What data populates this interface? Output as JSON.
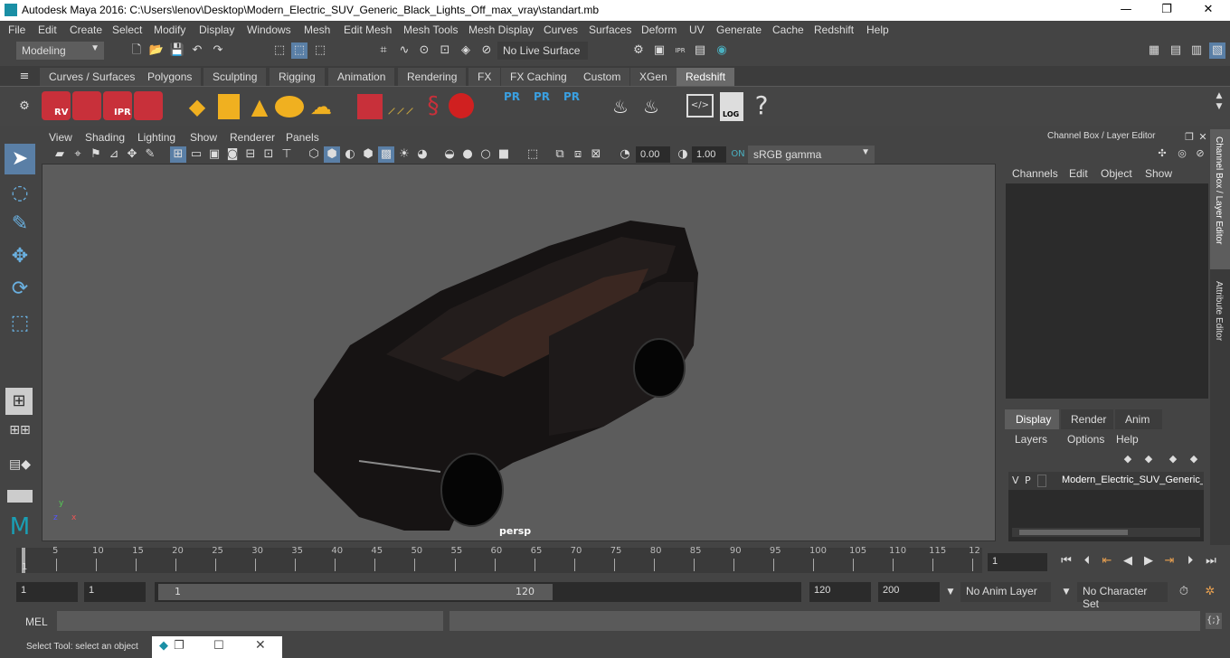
{
  "window": {
    "title": "Autodesk Maya 2016: C:\\Users\\lenov\\Desktop\\Modern_Electric_SUV_Generic_Black_Lights_Off_max_vray\\standart.mb",
    "minimize": "—",
    "maximize": "❐",
    "close": "✕"
  },
  "menu": [
    "File",
    "Edit",
    "Create",
    "Select",
    "Modify",
    "Display",
    "Windows",
    "Mesh",
    "Edit Mesh",
    "Mesh Tools",
    "Mesh Display",
    "Curves",
    "Surfaces",
    "Deform",
    "UV",
    "Generate",
    "Cache",
    "Redshift",
    "Help"
  ],
  "status": {
    "mode": "Modeling",
    "live_surface": "No Live Surface"
  },
  "shelf_tabs": [
    "Curves / Surfaces",
    "Polygons",
    "Sculpting",
    "Rigging",
    "Animation",
    "Rendering",
    "FX",
    "FX Caching",
    "Custom",
    "XGen",
    "Redshift"
  ],
  "shelf_active": "Redshift",
  "shelf_labels": {
    "rv": "RV",
    "ipr": "IPR",
    "pr1": "PR",
    "pr2": "PR",
    "pr3": "PR",
    "log": "LOG",
    "help": "?"
  },
  "view_menu": [
    "View",
    "Shading",
    "Lighting",
    "Show",
    "Renderer",
    "Panels"
  ],
  "view_toolbar": {
    "exposure": "0.00",
    "gamma": "1.00",
    "colorspace": "sRGB gamma"
  },
  "viewport": {
    "camera_label": "persp"
  },
  "channel_box": {
    "title": "Channel Box / Layer Editor",
    "menu": [
      "Channels",
      "Edit",
      "Object",
      "Show"
    ]
  },
  "layer_editor": {
    "tabs": [
      "Display",
      "Render",
      "Anim"
    ],
    "active_tab": "Display",
    "menu": [
      "Layers",
      "Options",
      "Help"
    ],
    "layer": {
      "v": "V",
      "p": "P",
      "name": "Modern_Electric_SUV_Generic_"
    }
  },
  "side_tabs": [
    "Channel Box / Layer Editor",
    "Attribute Editor"
  ],
  "timeline": {
    "ticks": [
      "5",
      "10",
      "15",
      "20",
      "25",
      "30",
      "35",
      "40",
      "45",
      "50",
      "55",
      "60",
      "65",
      "70",
      "75",
      "80",
      "85",
      "90",
      "95",
      "100",
      "105",
      "110",
      "115",
      "12"
    ],
    "start_marker": "1",
    "current_frame": "1"
  },
  "range": {
    "start": "1",
    "playback_start": "1",
    "slider_start": "1",
    "slider_end": "120",
    "playback_end": "120",
    "end": "200",
    "anim_layer": "No Anim Layer",
    "char_set": "No Character Set"
  },
  "command": {
    "label": "MEL"
  },
  "help_line": "Select Tool: select an object"
}
